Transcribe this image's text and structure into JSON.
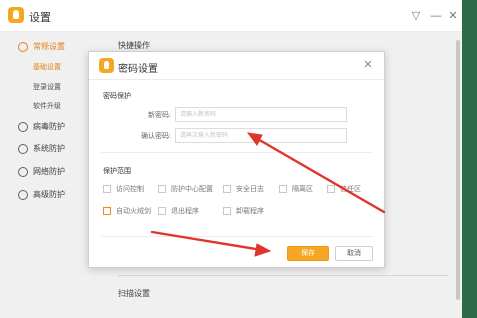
{
  "window": {
    "title": "设置"
  },
  "sidebar": {
    "items": [
      {
        "label": "常规设置",
        "active": true
      },
      {
        "label": "病毒防护"
      },
      {
        "label": "系统防护"
      },
      {
        "label": "网络防护"
      },
      {
        "label": "高级防护"
      }
    ],
    "subitems": [
      {
        "label": "基础设置",
        "active": true
      },
      {
        "label": "登录设置"
      },
      {
        "label": "软件升级"
      }
    ]
  },
  "content": {
    "quick_ops": "快捷操作",
    "scan_settings": "扫描设置"
  },
  "dialog": {
    "title": "密码设置",
    "password_section": "密码保护",
    "new_password_label": "新密码:",
    "new_password_placeholder": "请输入新密码",
    "confirm_password_label": "确认密码:",
    "confirm_password_placeholder": "请再次输入新密码",
    "scope_section": "保护范围",
    "scope_options": [
      "访问控制",
      "防护中心配置",
      "安全日志",
      "隔离区",
      "信任区",
      "自动火绒剑",
      "退出程序",
      "卸载程序"
    ],
    "save_label": "保存",
    "cancel_label": "取消"
  },
  "colors": {
    "accent": "#f08a1c",
    "button_primary": "#f5a623",
    "annotation_arrow": "#e0352b"
  }
}
